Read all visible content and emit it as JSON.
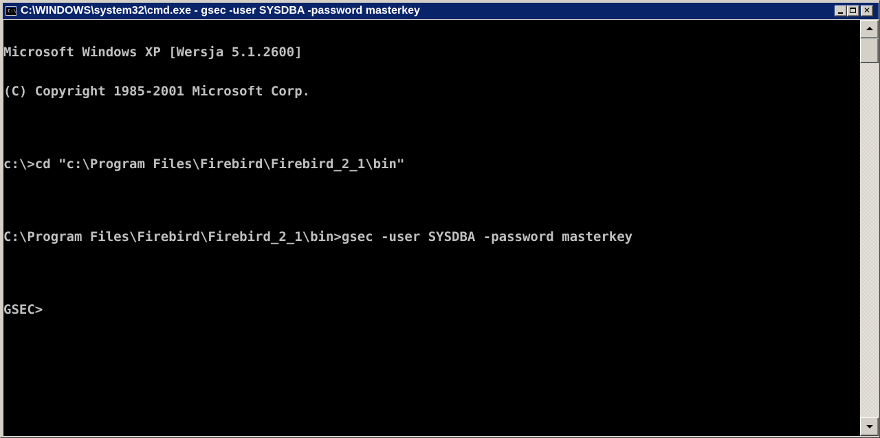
{
  "window": {
    "title": "C:\\WINDOWS\\system32\\cmd.exe - gsec -user SYSDBA -password masterkey",
    "icon": "cmd-app-icon",
    "icon_text": "C:\\",
    "controls": {
      "minimize_icon": "minimize-icon",
      "maximize_icon": "maximize-icon",
      "close_label": "✕"
    }
  },
  "console": {
    "lines": [
      "Microsoft Windows XP [Wersja 5.1.2600]",
      "(C) Copyright 1985-2001 Microsoft Corp.",
      "",
      "c:\\>cd \"c:\\Program Files\\Firebird\\Firebird_2_1\\bin\"",
      "",
      "C:\\Program Files\\Firebird\\Firebird_2_1\\bin>gsec -user SYSDBA -password masterkey",
      "",
      "GSEC>"
    ],
    "colors": {
      "background": "#000000",
      "text": "#c0c0c0"
    }
  },
  "scrollbar": {
    "up_icon": "scroll-up-arrow-icon",
    "down_icon": "scroll-down-arrow-icon"
  },
  "colors": {
    "titlebar": "#0a246a",
    "chrome": "#d4d0c8"
  }
}
